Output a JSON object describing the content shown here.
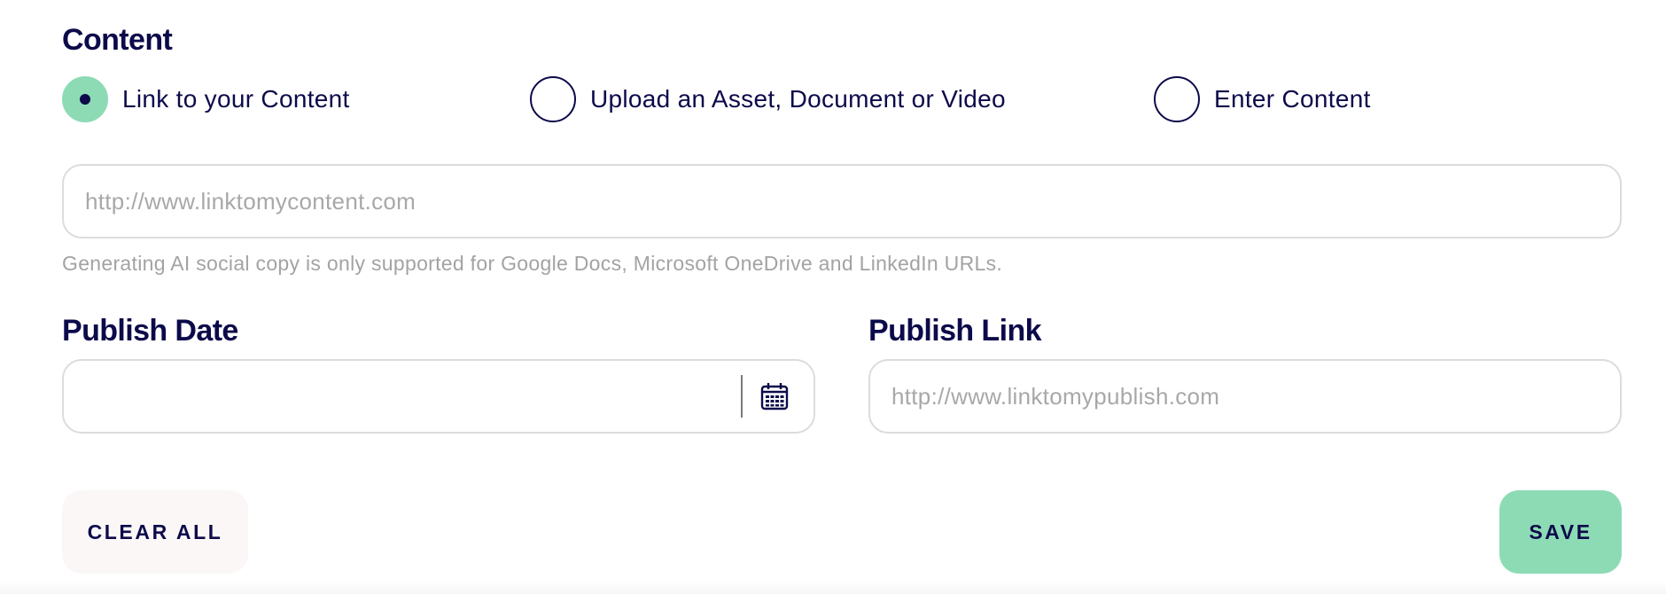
{
  "content": {
    "title": "Content",
    "options": [
      {
        "label": "Link to your Content",
        "checked": true
      },
      {
        "label": "Upload an Asset, Document or Video",
        "checked": false
      },
      {
        "label": "Enter Content",
        "checked": false
      }
    ],
    "link_input": {
      "value": "",
      "placeholder": "http://www.linktomycontent.com"
    },
    "helper_text": "Generating AI social copy is only supported for Google Docs, Microsoft OneDrive and LinkedIn URLs."
  },
  "publish_date": {
    "title": "Publish Date",
    "value": "",
    "icon": "calendar-icon"
  },
  "publish_link": {
    "title": "Publish Link",
    "value": "",
    "placeholder": "http://www.linktomypublish.com"
  },
  "actions": {
    "clear_label": "CLEAR ALL",
    "save_label": "SAVE"
  },
  "colors": {
    "accent": "#8ddbb5",
    "text_primary": "#0c0a4a",
    "placeholder": "#a8a8a8",
    "border": "#dcdcdc",
    "clear_bg": "#fbf7f7"
  }
}
